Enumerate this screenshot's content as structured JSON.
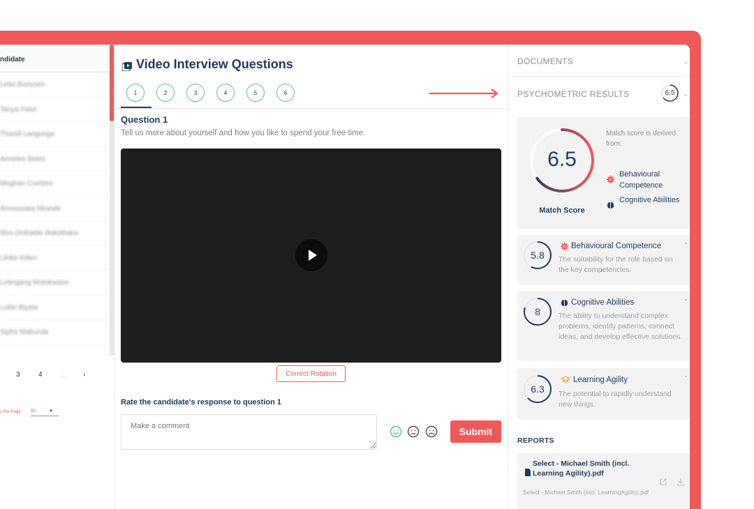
{
  "left": {
    "header": "ndidate",
    "candidates": [
      "Lebo Booysen",
      "Tanya Patel",
      "Thandi Langunga",
      "Annelee Botes",
      "Meghan Coetzee",
      "Amoussata Nkande",
      "Mvo Onthatile Bokothaka",
      "Ulrike Killen",
      "Lebogang Motokwane",
      "Lufile Biyela",
      "Sipho Makunda"
    ],
    "pagination": {
      "page3": "3",
      "page4": "4",
      "ellipsis": "...",
      "next": "›"
    },
    "per_page": {
      "label": "s Per Page",
      "value": "50"
    }
  },
  "middle": {
    "title": "Video Interview Questions",
    "steps": [
      "1",
      "2",
      "3",
      "4",
      "5",
      "6"
    ],
    "question_title": "Question 1",
    "question_text": "Tell us more about yourself and how you like to spend your free time.",
    "rotate_label": "Correct Rotation",
    "rate_label": "Rate the candidate's response to question 1",
    "comment_placeholder": "Make a comment",
    "submit_label": "Submit"
  },
  "right": {
    "documents_label": "DOCUMENTS",
    "psychometric_label": "PSYCHOMETRIC RESULTS",
    "psychometric_badge": "6.5",
    "match": {
      "score": "6.5",
      "score_fraction": 0.65,
      "label": "Match Score",
      "derived_text": "Match score is derived from:",
      "legend": [
        "Behavioural Competence",
        "Cognitive Abilities"
      ]
    },
    "cards": [
      {
        "score": "5.8",
        "fraction": 0.58,
        "title": "Behavioural Competence",
        "desc": "The suitability for the role based on the key competencies."
      },
      {
        "score": "8",
        "fraction": 0.8,
        "title": "Cognitive Abilities",
        "desc": "The ability to understand complex problems, identify patterns, connect ideas, and develop effective solutions."
      },
      {
        "score": "6.3",
        "fraction": 0.63,
        "title": "Learning Agility",
        "desc": "The potential to rapidly understand new things."
      }
    ],
    "reports_label": "REPORTS",
    "report": {
      "title": "Select - Michael Smith (incl. Learning Agility).pdf",
      "subtitle": "Select - Michael Smith (incl. LearningAgility).pdf"
    }
  },
  "colors": {
    "accent": "#f0585a",
    "navy": "#1e3a5f",
    "green": "#5cc77a",
    "gold": "#e8a93a"
  }
}
